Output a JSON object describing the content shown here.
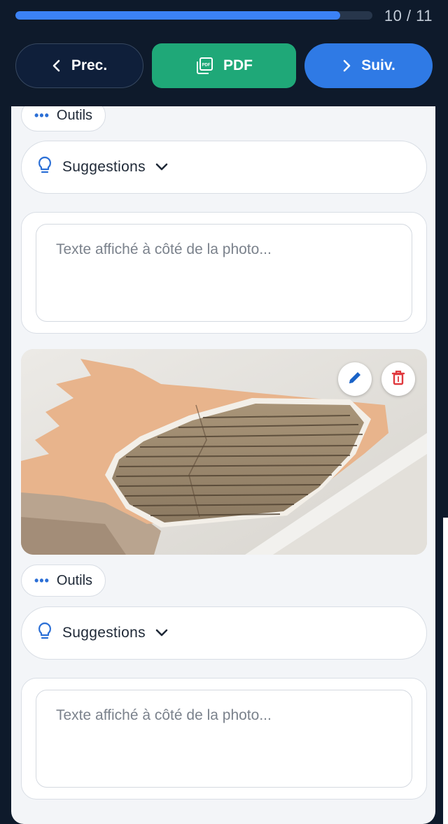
{
  "progress": {
    "label": "10 / 11",
    "fraction": 0.909,
    "color": "#3b82f6"
  },
  "nav": {
    "prev_label": "Prec.",
    "pdf_label": "PDF",
    "next_label": "Suiv."
  },
  "blocks": [
    {
      "tools_label": "Outils",
      "suggestions_label": "Suggestions",
      "caption_placeholder": "Texte affiché à côté de la photo..."
    },
    {
      "tools_label": "Outils",
      "suggestions_label": "Suggestions",
      "caption_placeholder": "Texte affiché à côté de la photo..."
    }
  ],
  "photo": {
    "icons": [
      "pencil-icon",
      "trash-icon"
    ]
  },
  "colors": {
    "header_bg": "#0e1a2b",
    "pdf_green": "#1fa878",
    "next_blue": "#2f7ae5",
    "delete_red": "#e0393e",
    "accent_blue": "#2b6fd6"
  }
}
